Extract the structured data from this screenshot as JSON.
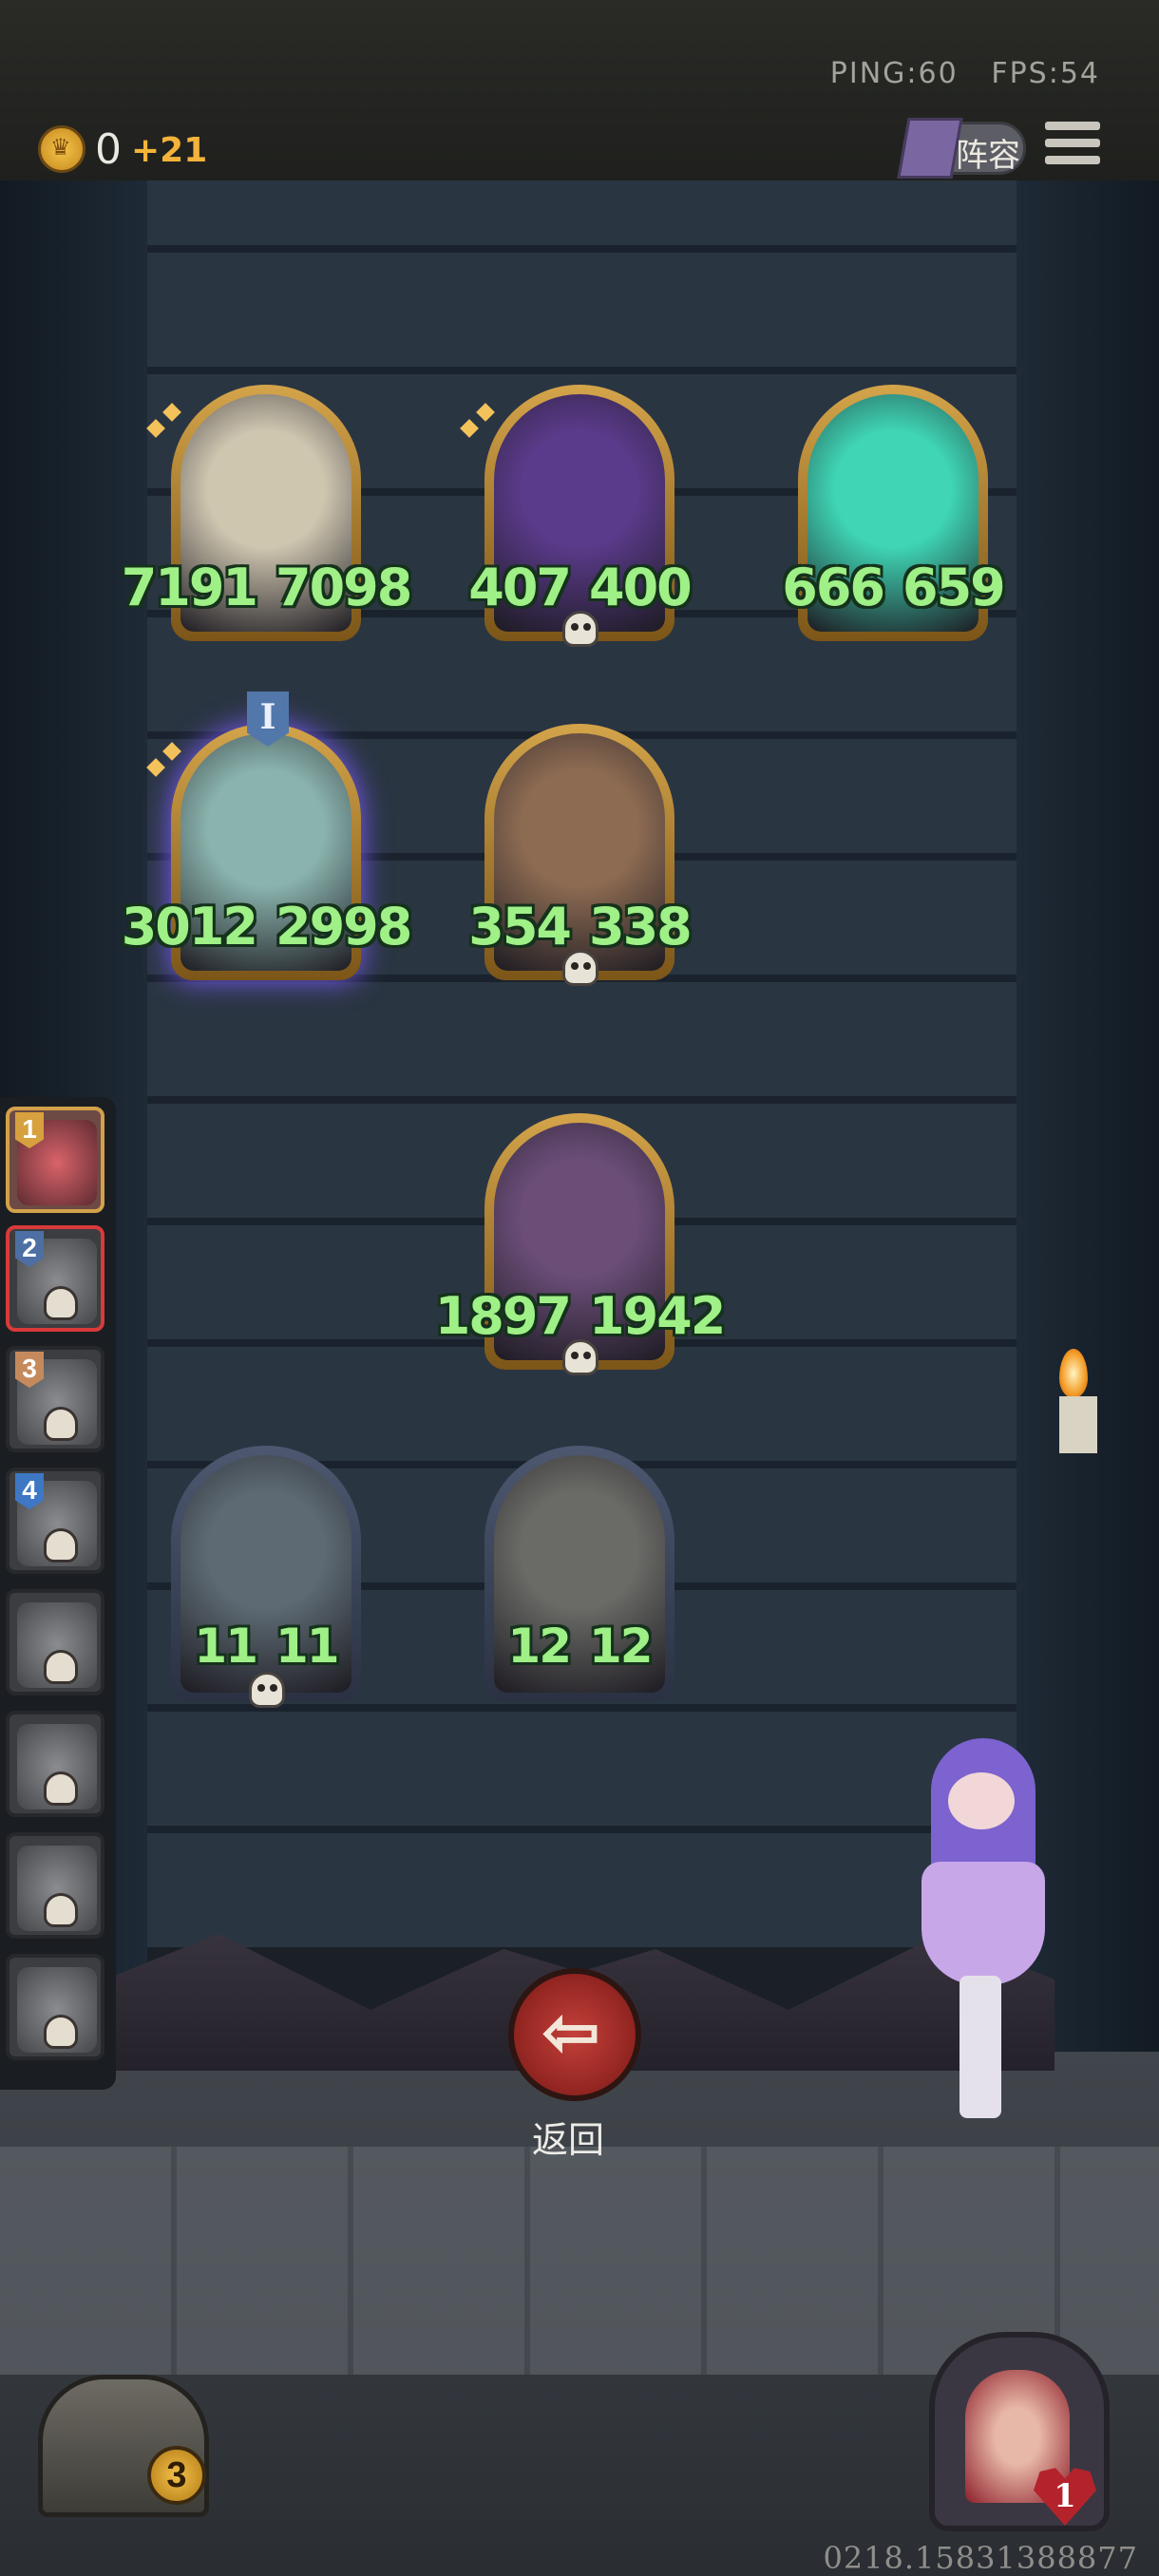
{
  "topbar": {
    "ping": "PING:60",
    "fps": "FPS:54",
    "coins": "0",
    "coin_income": "+21",
    "lineup_label": "阵容"
  },
  "board": {
    "cards": [
      {
        "id": "pumpkin",
        "attack": "7191",
        "health": "7098",
        "art_color": "#cfc6b0",
        "frame": "gold",
        "has_skull": false
      },
      {
        "id": "sorceress",
        "attack": "407",
        "health": "400",
        "art_color": "#5a3a8a",
        "frame": "gold",
        "has_skull": true
      },
      {
        "id": "spectral-king",
        "attack": "666",
        "health": "659",
        "art_color": "#3fd5b5",
        "frame": "gold",
        "has_skull": false
      },
      {
        "id": "dragon-horse",
        "attack": "3012",
        "health": "2998",
        "art_color": "#8ab3ad",
        "frame": "gold-glow",
        "has_skull": false,
        "rank": "I"
      },
      {
        "id": "dwarf-king",
        "attack": "354",
        "health": "338",
        "art_color": "#8d6b52",
        "frame": "gold",
        "has_skull": true
      },
      {
        "id": "cyborg-guy",
        "attack": "1897",
        "health": "1942",
        "art_color": "#6b4d78",
        "frame": "gold",
        "has_skull": true
      },
      {
        "id": "robot-bell",
        "attack": "11",
        "health": "11",
        "art_color": "#5d6a73",
        "frame": "stone",
        "has_skull": true
      },
      {
        "id": "airship",
        "attack": "12",
        "health": "12",
        "art_color": "#6a6a66",
        "frame": "stone",
        "has_skull": false
      }
    ]
  },
  "queue": {
    "slots": [
      {
        "number": "1",
        "state": "current"
      },
      {
        "number": "2",
        "state": "eliminated"
      },
      {
        "number": "3",
        "state": "eliminated"
      },
      {
        "number": "4",
        "state": "eliminated"
      },
      {
        "number": "",
        "state": "eliminated"
      },
      {
        "number": "",
        "state": "eliminated"
      },
      {
        "number": "",
        "state": "eliminated"
      },
      {
        "number": "",
        "state": "eliminated"
      }
    ]
  },
  "back_label": "返回",
  "chest": {
    "count": "3"
  },
  "player": {
    "hearts": "1"
  },
  "session_id": "0218.15831388877"
}
